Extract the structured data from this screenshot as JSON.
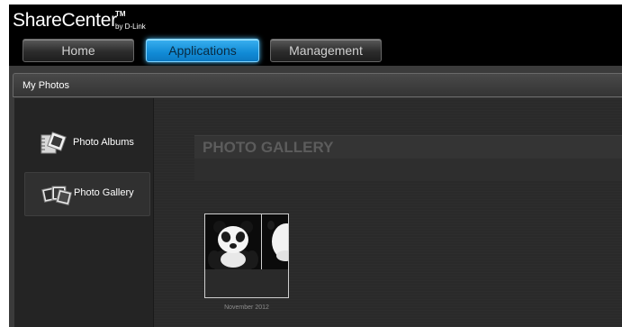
{
  "brand": {
    "name": "ShareCenter",
    "tm": "TM",
    "by": "by D-Link"
  },
  "nav": {
    "tabs": [
      {
        "label": "Home",
        "active": false
      },
      {
        "label": "Applications",
        "active": true
      },
      {
        "label": "Management",
        "active": false
      }
    ]
  },
  "panel": {
    "title": "My Photos"
  },
  "sidebar": {
    "items": [
      {
        "label": "Photo Albums",
        "icon": "photo-albums-icon",
        "selected": false
      },
      {
        "label": "Photo Gallery",
        "icon": "photo-gallery-icon",
        "selected": true
      }
    ]
  },
  "gallery": {
    "heading": "PHOTO GALLERY",
    "albums": [
      {
        "caption": "November 2012"
      }
    ]
  },
  "colors": {
    "accent": "#118bd6",
    "header_bg": "#000000",
    "panel_bg": "#272727"
  }
}
